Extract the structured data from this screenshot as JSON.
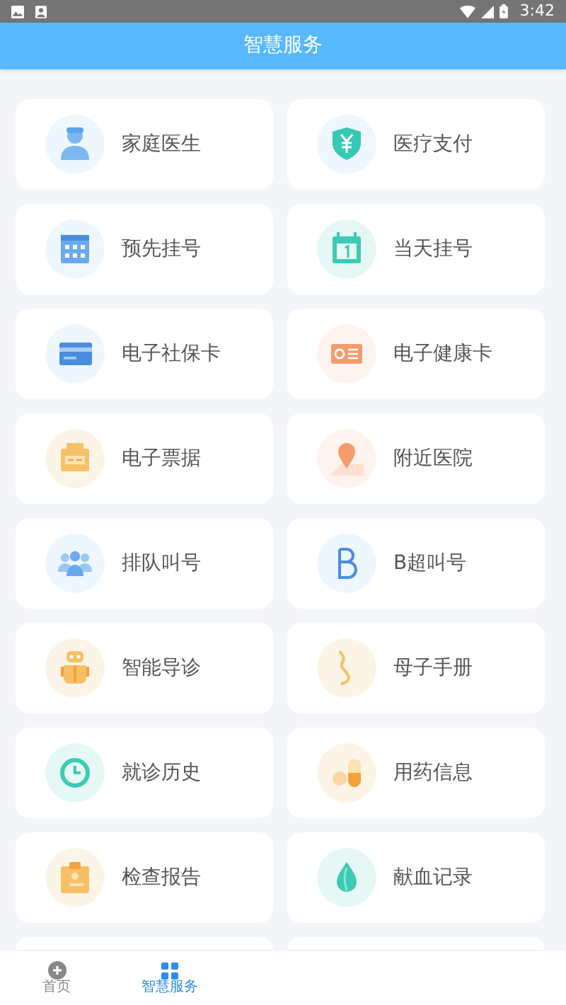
{
  "status_bar": {
    "time": "3:42"
  },
  "header": {
    "title": "智慧服务"
  },
  "services": [
    {
      "kind": "service",
      "label": "家庭医生"
    },
    {
      "kind": "service",
      "label": "医疗支付"
    },
    {
      "kind": "service",
      "label": "预先挂号"
    },
    {
      "kind": "service",
      "label": "当天挂号"
    },
    {
      "kind": "service",
      "label": "电子社保卡"
    },
    {
      "kind": "service",
      "label": "电子健康卡"
    },
    {
      "kind": "service",
      "label": "电子票据"
    },
    {
      "kind": "service",
      "label": "附近医院"
    },
    {
      "kind": "service",
      "label": "排队叫号"
    },
    {
      "kind": "service",
      "label": "B超叫号"
    },
    {
      "kind": "service",
      "label": "智能导诊"
    },
    {
      "kind": "service",
      "label": "母子手册"
    },
    {
      "kind": "service",
      "label": "就诊历史"
    },
    {
      "kind": "service",
      "label": "用药信息"
    },
    {
      "kind": "service",
      "label": "检查报告"
    },
    {
      "kind": "service",
      "label": "献血记录"
    },
    {
      "kind": "cut"
    },
    {
      "kind": "cut"
    }
  ],
  "bottom_nav": [
    {
      "label": "首页",
      "selected": false
    },
    {
      "label": "智慧服务",
      "selected": true
    }
  ]
}
